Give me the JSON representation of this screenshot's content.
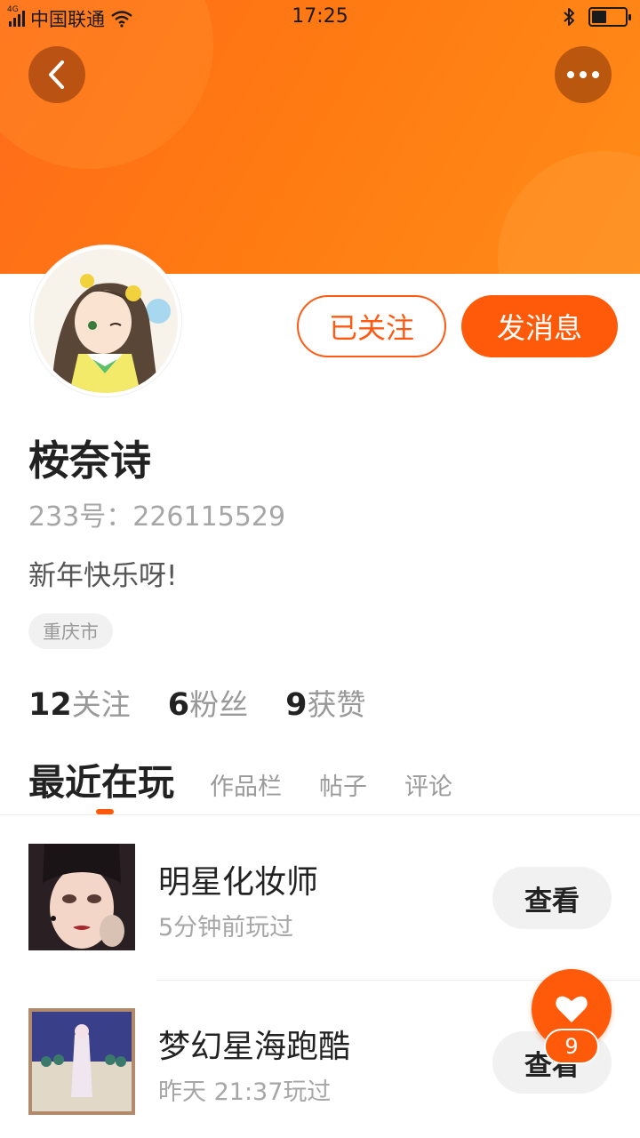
{
  "status_bar": {
    "network_tag": "4G",
    "carrier": "中国联通",
    "time": "17:25",
    "battery_level": 0.45
  },
  "header": {
    "back_icon": "chevron-left-icon",
    "more_icon": "more-dots-icon",
    "accent": "#ff5a0a"
  },
  "profile": {
    "name": "桉奈诗",
    "uid": "233号：226115529",
    "bio": "新年快乐呀!",
    "location": "重庆市",
    "follow_label": "已关注",
    "message_label": "发消息"
  },
  "stats": [
    {
      "num": "12",
      "label": "关注"
    },
    {
      "num": "6",
      "label": "粉丝"
    },
    {
      "num": "9",
      "label": "获赞"
    }
  ],
  "tabs": {
    "active": "最近在玩",
    "items": [
      "作品栏",
      "帖子",
      "评论"
    ]
  },
  "games": [
    {
      "title": "明星化妆师",
      "sub": "5分钟前玩过",
      "action": "查看"
    },
    {
      "title": "梦幻星海跑酷",
      "sub": "昨天 21:37玩过",
      "action": "查看"
    }
  ],
  "like_fab": {
    "icon": "heart-icon",
    "count": "9"
  }
}
